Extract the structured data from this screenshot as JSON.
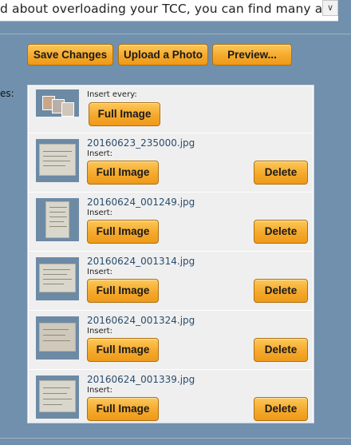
{
  "editor": {
    "text_fragment": "d about overloading your TCC, you can find many a",
    "scroll_icon": "chevron-down-icon"
  },
  "toolbar": {
    "save_label": "Save Changes",
    "upload_label": "Upload a Photo",
    "preview_label": "Preview..."
  },
  "side_label": "es:",
  "gallery": {
    "header": {
      "insert_label": "Insert every:",
      "full_image_label": "Full Image"
    },
    "photos": [
      {
        "filename": "20160623_235000.jpg",
        "insert_label": "Insert:",
        "full_image_label": "Full Image",
        "delete_label": "Delete"
      },
      {
        "filename": "20160624_001249.jpg",
        "insert_label": "Insert:",
        "full_image_label": "Full Image",
        "delete_label": "Delete"
      },
      {
        "filename": "20160624_001314.jpg",
        "insert_label": "Insert:",
        "full_image_label": "Full Image",
        "delete_label": "Delete"
      },
      {
        "filename": "20160624_001324.jpg",
        "insert_label": "Insert:",
        "full_image_label": "Full Image",
        "delete_label": "Delete"
      },
      {
        "filename": "20160624_001339.jpg",
        "insert_label": "Insert:",
        "full_image_label": "Full Image",
        "delete_label": "Delete"
      }
    ]
  },
  "colors": {
    "page_background": "#7190ad",
    "button_orange": "#f5a92b",
    "filename_blue": "#2a4d6e"
  }
}
